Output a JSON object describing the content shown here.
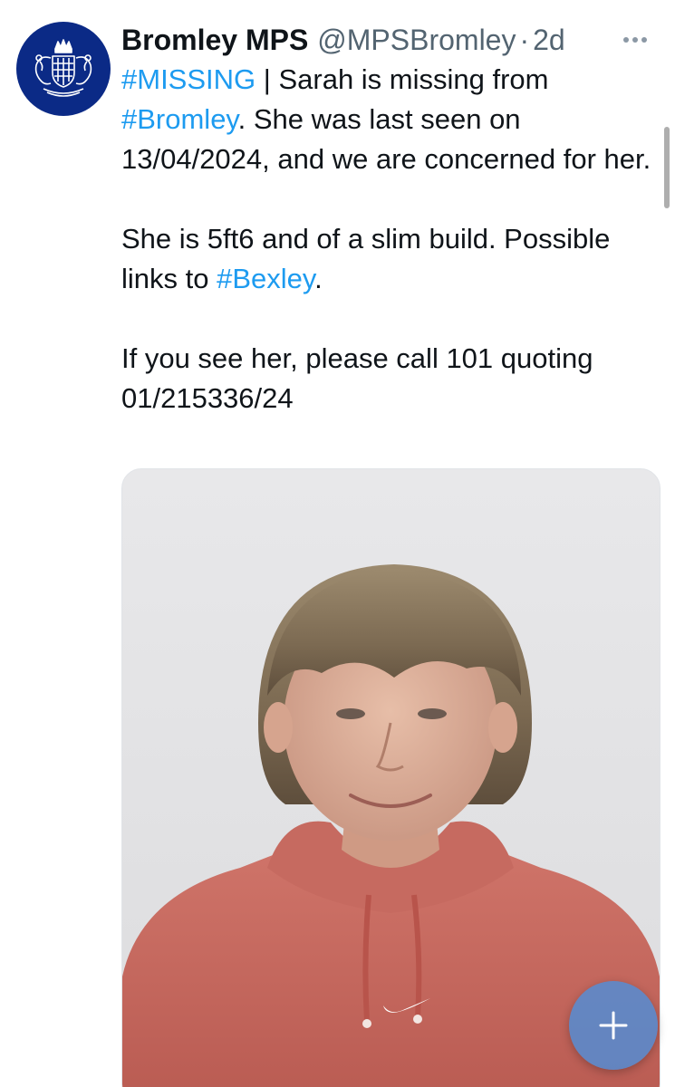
{
  "tweet": {
    "author": {
      "name": "Bromley MPS",
      "handle": "@MPSBromley",
      "separator": "·",
      "time": "2d",
      "avatar_icon": "metropolitan-police-crest-icon"
    },
    "paragraph1": {
      "tag_missing": "#MISSING",
      "pipe": "|",
      "text_a": " Sarah is missing from ",
      "tag_bromley": "#Bromley",
      "text_b": ". She was last seen on 13/04/2024, and we are concerned for her."
    },
    "paragraph2": {
      "text_a": "She is 5ft6 and of a slim build. Possible links to ",
      "tag_bexley": "#Bexley",
      "text_b": "."
    },
    "paragraph3": {
      "text": "If you see her, please call 101 quoting 01/215336/24"
    },
    "media": {
      "description_icon": "missing-person-photo"
    },
    "fab": {
      "icon": "plus-icon"
    },
    "more_icon": "more-options-icon"
  },
  "colors": {
    "link": "#1d9bf0",
    "text": "#0f1419",
    "muted": "#536471",
    "avatar_bg": "#0b2a86",
    "fab": "#4a8fde",
    "hoodie": "#c8685d"
  }
}
